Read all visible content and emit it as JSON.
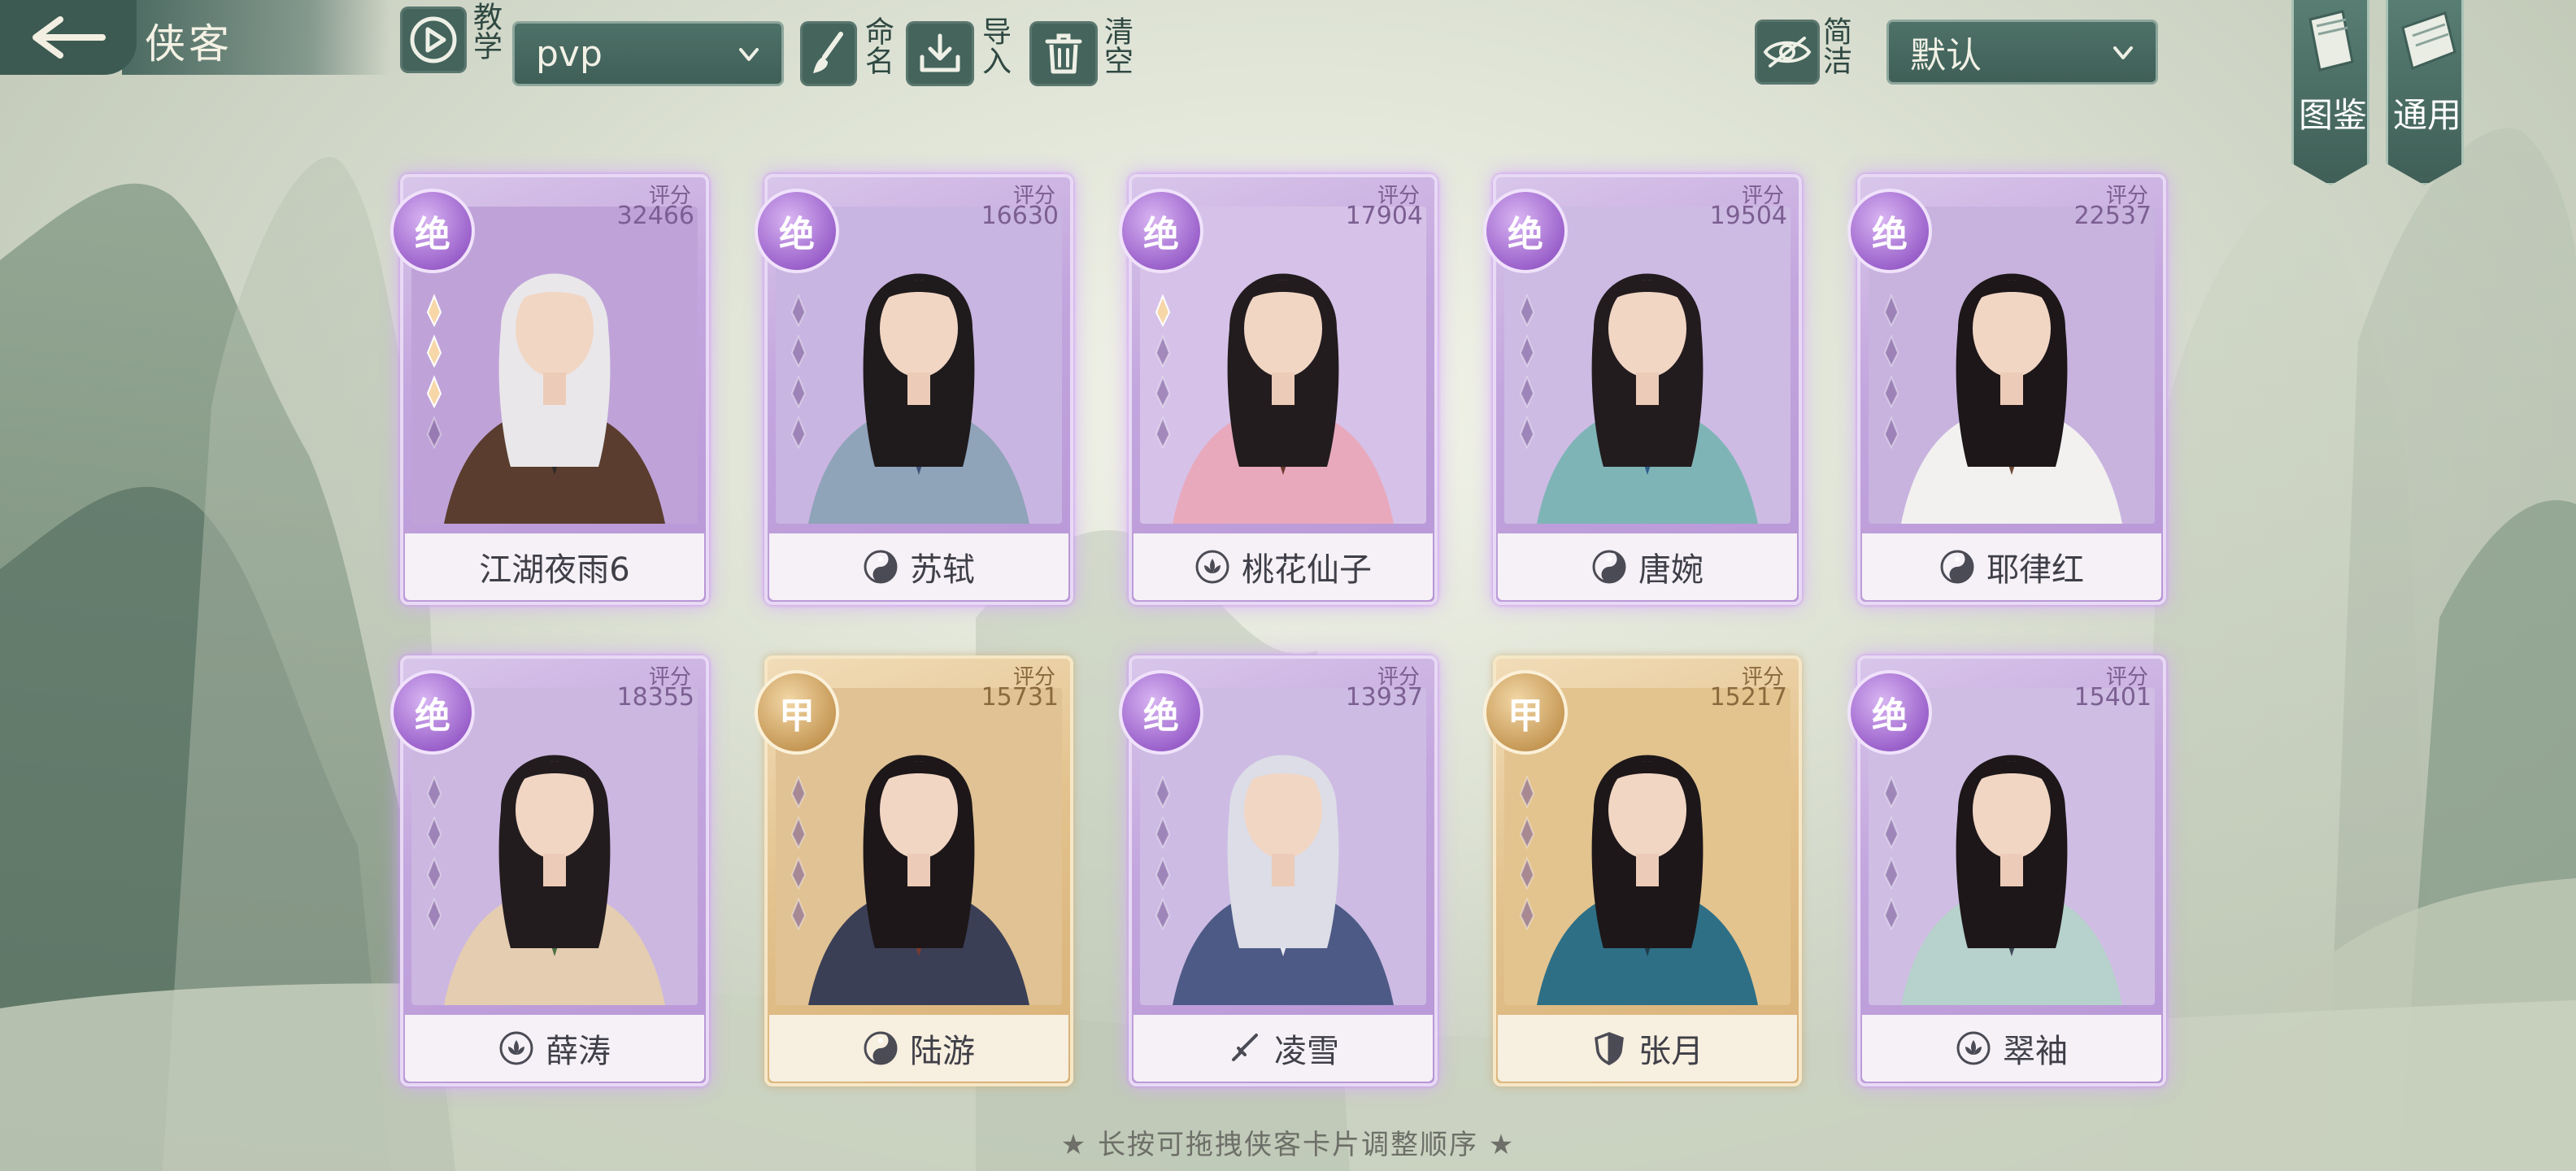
{
  "header": {
    "title": "侠客",
    "tutorial_label": "教学",
    "preset_select": "pvp",
    "rename_label": "命名",
    "import_label": "导入",
    "clear_label": "清空",
    "simple_label": "简洁",
    "sort_select": "默认",
    "gallery_label": "图鉴",
    "general_label": "通用"
  },
  "score_label": "评分",
  "cards": [
    {
      "name": "江湖夜雨6",
      "score": "32466",
      "rank": "绝",
      "tier": "purple",
      "faction_icon": "",
      "stars": 3
    },
    {
      "name": "苏轼",
      "score": "16630",
      "rank": "绝",
      "tier": "purple",
      "faction_icon": "yin-yang-icon",
      "stars": 0
    },
    {
      "name": "桃花仙子",
      "score": "17904",
      "rank": "绝",
      "tier": "purple",
      "faction_icon": "lotus-icon",
      "stars": 1
    },
    {
      "name": "唐婉",
      "score": "19504",
      "rank": "绝",
      "tier": "purple",
      "faction_icon": "yin-yang-icon",
      "stars": 0
    },
    {
      "name": "耶律红",
      "score": "22537",
      "rank": "绝",
      "tier": "purple",
      "faction_icon": "yin-yang-icon",
      "stars": 0
    },
    {
      "name": "薛涛",
      "score": "18355",
      "rank": "绝",
      "tier": "purple",
      "faction_icon": "lotus-icon",
      "stars": 0
    },
    {
      "name": "陆游",
      "score": "15731",
      "rank": "甲",
      "tier": "gold",
      "faction_icon": "yin-yang-icon",
      "stars": 0
    },
    {
      "name": "凌雪",
      "score": "13937",
      "rank": "绝",
      "tier": "purple",
      "faction_icon": "sword-icon",
      "stars": 0
    },
    {
      "name": "张月",
      "score": "15217",
      "rank": "甲",
      "tier": "gold",
      "faction_icon": "shield-icon",
      "stars": 0
    },
    {
      "name": "翠袖",
      "score": "15401",
      "rank": "绝",
      "tier": "purple",
      "faction_icon": "lotus-icon",
      "stars": 0
    }
  ],
  "footer_tip": "★ 长按可拖拽侠客卡片调整顺序 ★",
  "colors": {
    "header_green": "#3f5f57",
    "purple_card": "#c3a6de",
    "gold_card": "#e3c28d"
  }
}
